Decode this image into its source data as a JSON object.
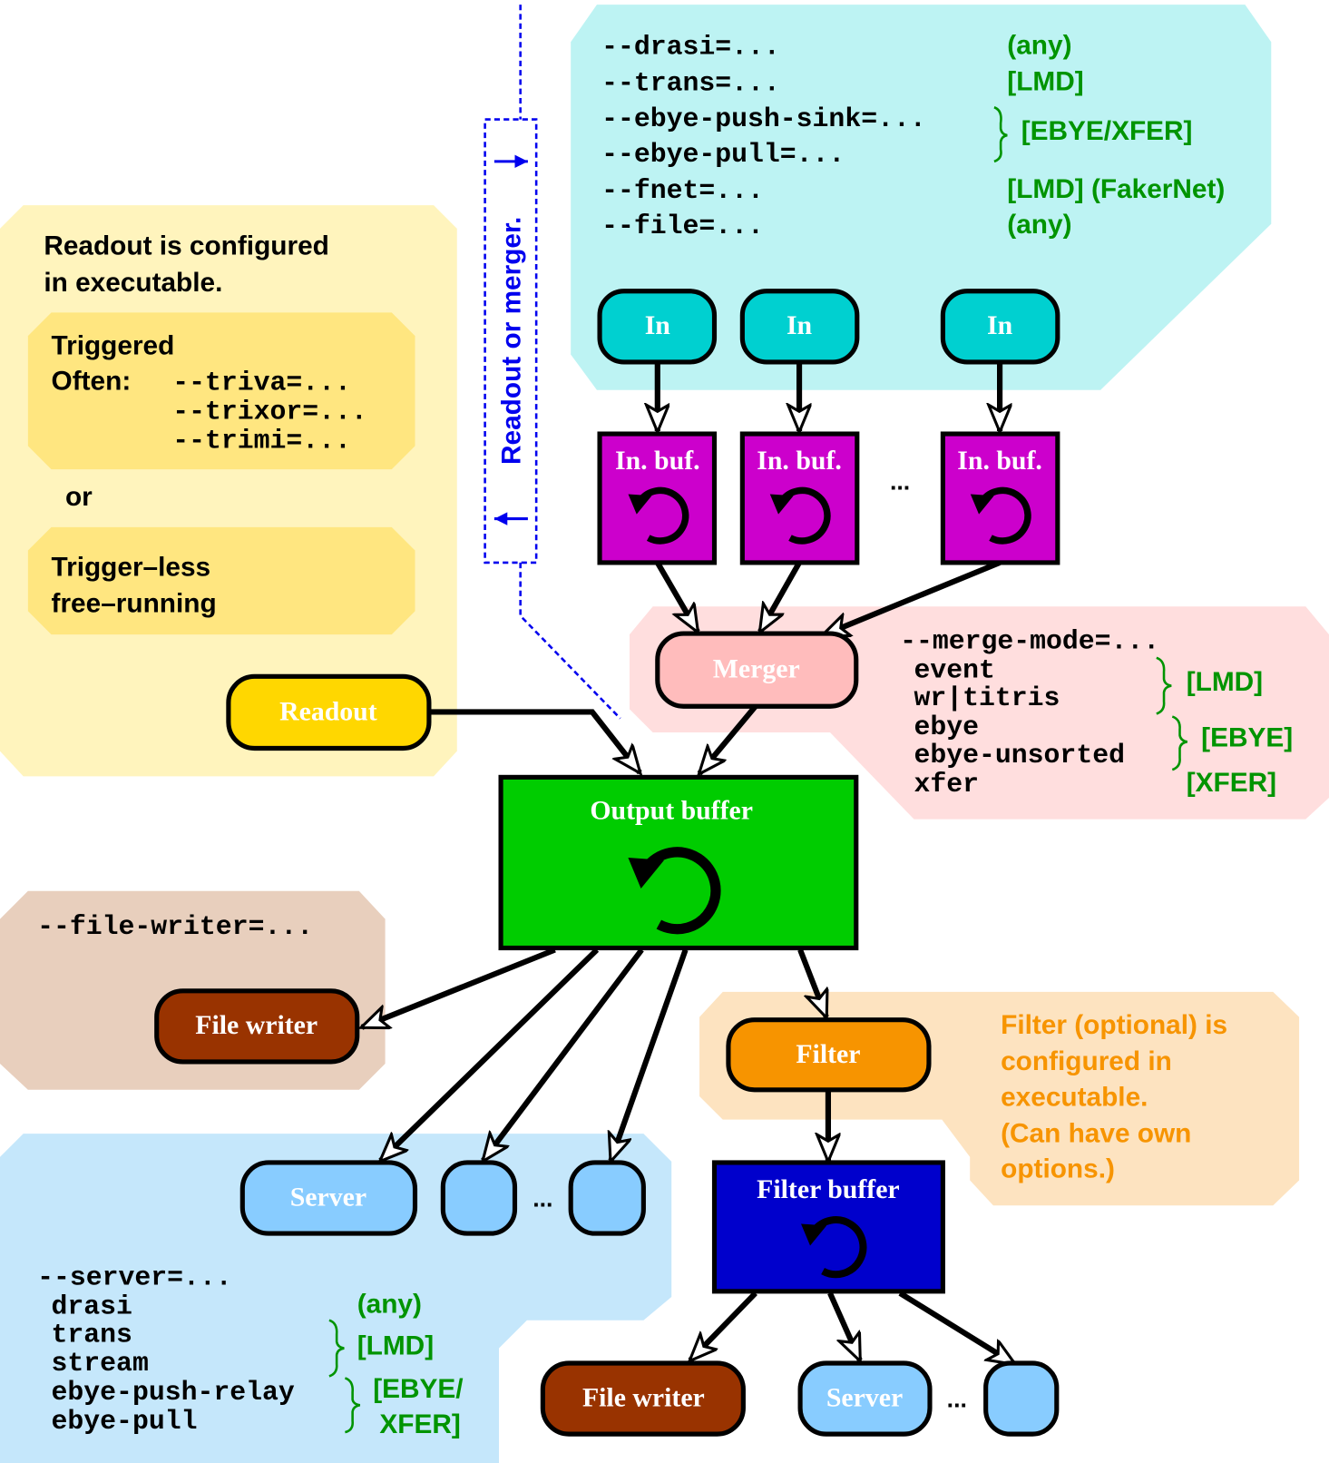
{
  "colors": {
    "input_region": "#bdf3f3",
    "readout_region": "#fff4bd",
    "trigger_box": "#ffe680",
    "merger_region": "#ffdede",
    "filewriter_region": "#e8cfbd",
    "filter_region": "#fde3c0",
    "server_region": "#c5e7fb",
    "in_node": "#00d0d0",
    "in_buf": "#cc00cc",
    "merger": "#ffbcbc",
    "readout": "#ffd700",
    "output_buffer": "#00cc00",
    "file_writer": "#993300",
    "filter": "#f79400",
    "filter_buffer": "#0000cc",
    "server": "#88ccff",
    "note_green": "#009400",
    "blue_dashed": "#0000ee"
  },
  "inputs": {
    "options": [
      "--drasi=...",
      "--trans=...",
      "--ebye-push-sink=...",
      "--ebye-pull=...",
      "--fnet=...",
      "--file=..."
    ],
    "notes": [
      "(any)",
      "[LMD]",
      "[EBYE/XFER]",
      "[LMD] (FakerNet)",
      "(any)"
    ],
    "node_label": "In",
    "buffer_label": "In. buf.",
    "ellipsis": "..."
  },
  "readout_panel": {
    "line1": "Readout is configured",
    "line2": "in executable.",
    "triggered": "Triggered",
    "often": "Often:",
    "trigger_options": [
      "--triva=...",
      "--trixor=...",
      "--trimi=..."
    ],
    "or": "or",
    "triggerless1": "Trigger–less",
    "triggerless2": "free–running",
    "node_label": "Readout"
  },
  "readout_or_merger": "Readout or merger.",
  "merger": {
    "node_label": "Merger",
    "option": "--merge-mode=...",
    "modes": [
      "event",
      "wr|titris",
      "ebye",
      "ebye-unsorted",
      "xfer"
    ],
    "notes": [
      "[LMD]",
      "[EBYE]",
      "[XFER]"
    ]
  },
  "output_buffer": {
    "label": "Output buffer"
  },
  "file_writer": {
    "option": "--file-writer=...",
    "node_label": "File writer"
  },
  "filter": {
    "node_label": "Filter",
    "description": [
      "Filter (optional) is",
      "configured in",
      "executable.",
      "(Can have own",
      "options.)"
    ],
    "buffer_label": "Filter buffer"
  },
  "server": {
    "node_label": "Server",
    "option": "--server=...",
    "types": [
      "drasi",
      "trans",
      "stream",
      "ebye-push-relay",
      "ebye-pull"
    ],
    "notes": [
      "(any)",
      "[LMD]",
      "[EBYE/",
      "XFER]"
    ],
    "ellipsis": "..."
  },
  "filter_outputs": {
    "file_writer": "File writer",
    "server": "Server",
    "ellipsis": "..."
  }
}
